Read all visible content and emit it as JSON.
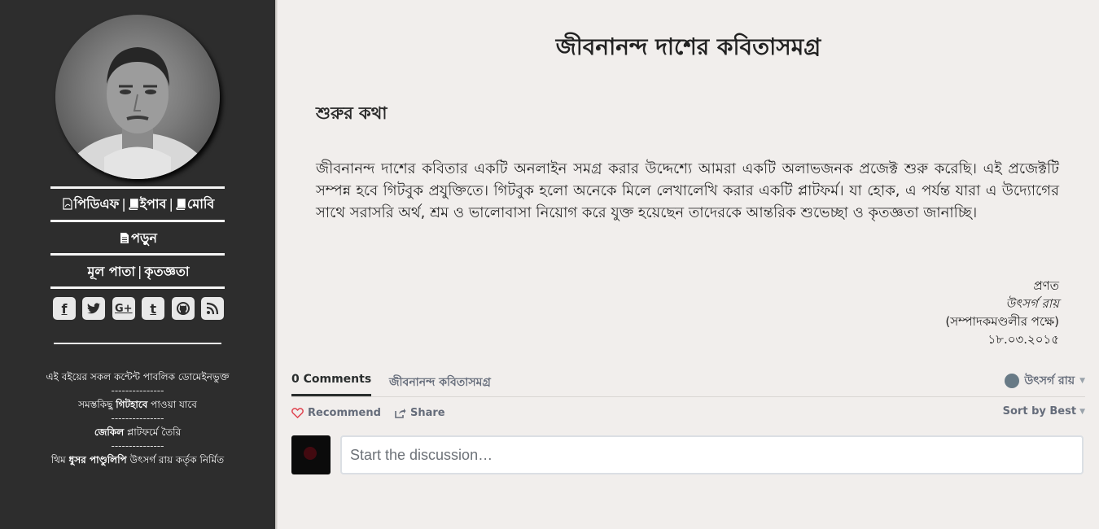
{
  "sidebar": {
    "downloads": {
      "pdf": "পিডিএফ",
      "epub": "ইপাব",
      "mobi": "মোবি",
      "sep": "|"
    },
    "read": "পড়ুন",
    "nav": {
      "home": "মূল পাতা",
      "thanks": "কৃতজ্ঞতা",
      "sep": "|"
    },
    "social": [
      "facebook-icon",
      "twitter-icon",
      "google-plus-icon",
      "tumblr-icon",
      "github-icon",
      "rss-icon"
    ],
    "footer": {
      "line1": "এই বইয়ের সকল কন্টেন্ট পাবলিক ডোমেইনভুক্ত",
      "dash": "---------------",
      "line2_pre": "সমস্তকিছু ",
      "line2_bold": "গিটহাবে",
      "line2_post": " পাওয়া যাবে",
      "line3_bold": "জেকিল",
      "line3_post": " প্লাটফর্মে তৈরি",
      "line4_pre": "থিম ",
      "line4_bold": "ধুসর পাণ্ডুলিপি",
      "line4_post": " উৎসর্গ রায় কর্তৃক নির্মিত"
    }
  },
  "main": {
    "title": "জীবনানন্দ দাশের কবিতাসমগ্র",
    "heading": "শুরুর কথা",
    "paragraph": "জীবনানন্দ দাশের কবিতার একটি অনলাইন সমগ্র করার উদ্দেশ্যে আমরা একটি অলাভজনক প্রজেক্ট শুরু করেছি। এই প্রজেক্টটি সম্পন্ন হবে গিটবুক প্রযুক্তিতে। গিটবুক হলো অনেকে মিলে লেখালেখি করার একটি প্লাটফর্ম। যা হোক, এ পর্যন্ত যারা এ উদ্যোগের সাথে সরাসরি অর্থ, শ্রম ও ভালোবাসা নিয়োগ করে যুক্ত হয়েছেন তাদেরকে আন্তরিক শুভেচ্ছা ও কৃতজ্ঞতা জানাচ্ছি।",
    "signature": {
      "label": "প্রণত",
      "name": "উৎসর্গ রায়",
      "role": "(সম্পাদকমণ্ডলীর পক্ষে)",
      "date": "১৮.০৩.২০১৫"
    }
  },
  "comments": {
    "count_label": "0 Comments",
    "site_name": "জীবনানন্দ কবিতাসমগ্র",
    "user_name": "উৎসর্গ রায়",
    "recommend": "Recommend",
    "share": "Share",
    "sort": "Sort by Best",
    "placeholder": "Start the discussion…"
  }
}
